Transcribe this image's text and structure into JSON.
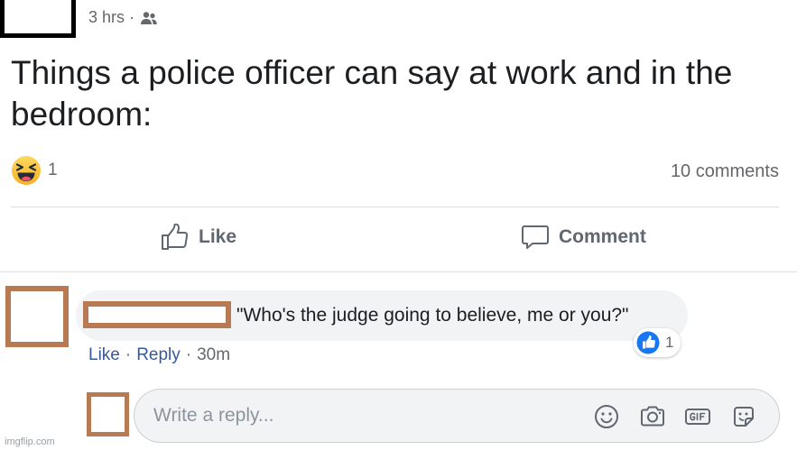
{
  "post": {
    "time": "3 hrs",
    "separator": "·",
    "audience_icon": "friends-icon",
    "text": "Things a police officer can say at work and in the bedroom:",
    "reaction_icon": "haha-emoji-icon",
    "reaction_count": "1",
    "comments_count": "10 comments"
  },
  "actions": {
    "like_label": "Like",
    "comment_label": "Comment"
  },
  "comment": {
    "text": "\"Who's the judge going to believe, me or you?\"",
    "reaction_icon": "like-reaction-icon",
    "reaction_count": "1",
    "like_label": "Like",
    "reply_label": "Reply",
    "separator": "·",
    "time": "30m"
  },
  "reply": {
    "placeholder": "Write a reply...",
    "tools": [
      "emoji-icon",
      "camera-icon",
      "gif-icon",
      "sticker-icon"
    ]
  },
  "watermark": "imgflip.com",
  "colors": {
    "link_blue": "#385898",
    "meta_gray": "#65676b",
    "bubble_gray": "#f2f3f5",
    "redaction_brown": "#b87a52",
    "like_blue": "#1877f2",
    "haha_yellow": "#f7b125"
  }
}
